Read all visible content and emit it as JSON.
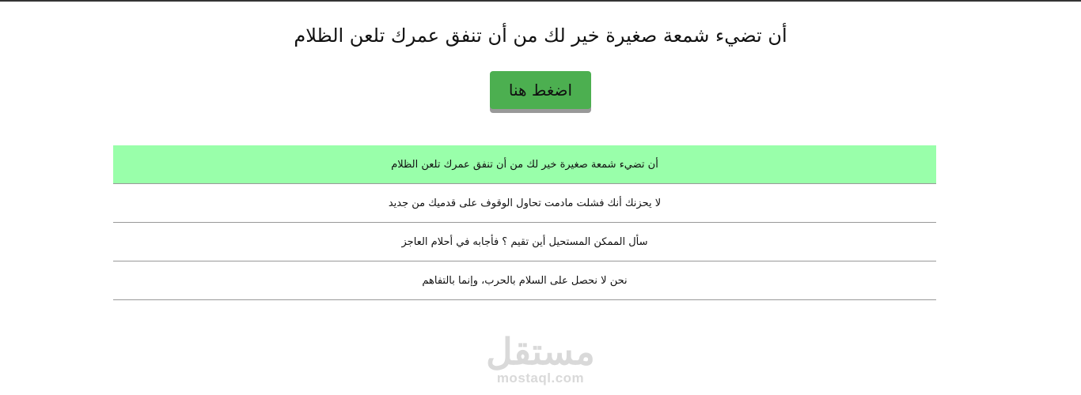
{
  "page": {
    "title": "أن تضيء شمعة صغيرة خير لك من أن تنفق عمرك تلعن الظلام",
    "button_label": "اضغط هنا"
  },
  "quotes": [
    {
      "text": "أن تضيء شمعة صغيرة خير لك من أن تنفق عمرك تلعن الظلام",
      "active": true
    },
    {
      "text": "لا يحزنك أنك فشلت مادمت تحاول الوقوف على قدميك من جديد",
      "active": false
    },
    {
      "text": "سأل الممكن المستحيل أين تقيم ؟ فأجابه في أحلام العاجز",
      "active": false
    },
    {
      "text": "نحن لا نحصل على السلام بالحرب، وإنما بالتفاهم",
      "active": false
    }
  ],
  "watermark": {
    "arabic": "مستقل",
    "latin": "mostaql.com"
  },
  "colors": {
    "button": "#4caf50",
    "active_row": "#99ffaa",
    "divider": "#999999"
  }
}
